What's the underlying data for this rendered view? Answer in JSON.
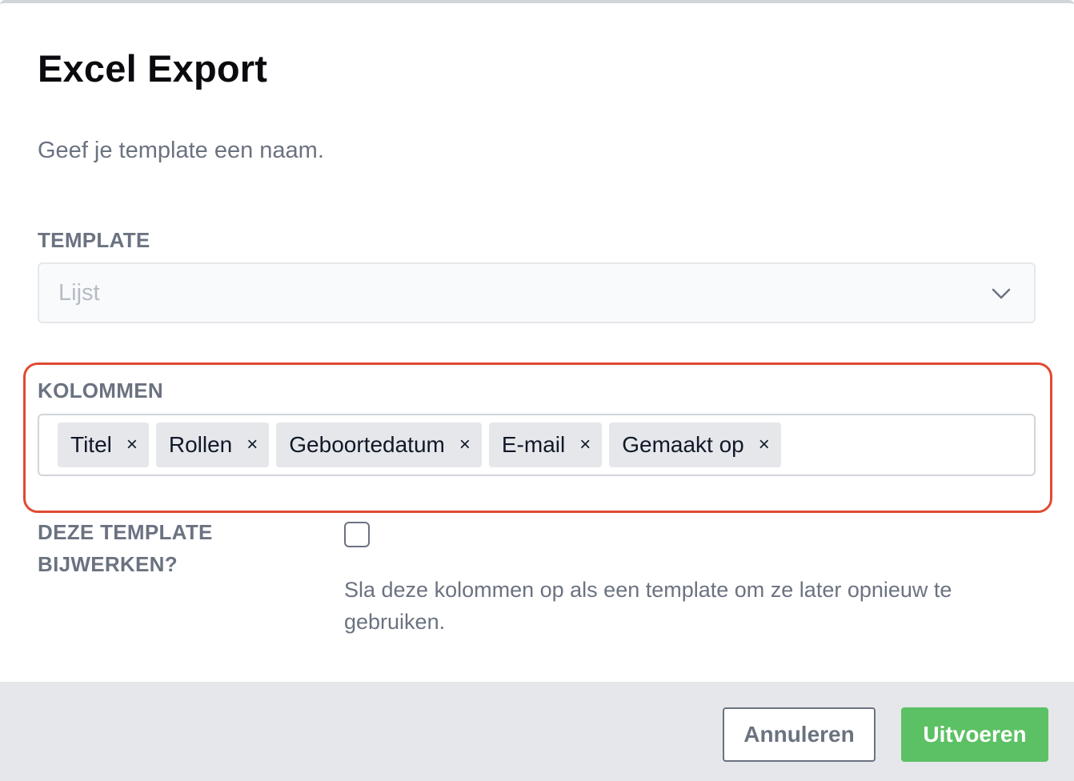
{
  "dialog": {
    "title": "Excel Export",
    "description": "Geef je template een naam."
  },
  "template_field": {
    "label": "TEMPLATE",
    "value": "Lijst",
    "icon": "chevron-down-icon"
  },
  "columns_field": {
    "label": "KOLOMMEN",
    "tags": [
      {
        "label": "Titel",
        "remove": "×"
      },
      {
        "label": "Rollen",
        "remove": "×"
      },
      {
        "label": "Geboortedatum",
        "remove": "×"
      },
      {
        "label": "E-mail",
        "remove": "×"
      },
      {
        "label": "Gemaakt op",
        "remove": "×"
      }
    ],
    "highlight_color": "#e04a32"
  },
  "update_field": {
    "label": "DEZE TEMPLATE BIJWERKEN?",
    "checked": false,
    "help_text": "Sla deze kolommen op als een template om ze later opnieuw te gebruiken."
  },
  "footer": {
    "cancel_label": "Annuleren",
    "submit_label": "Uitvoeren",
    "submit_color": "#5cc164"
  }
}
